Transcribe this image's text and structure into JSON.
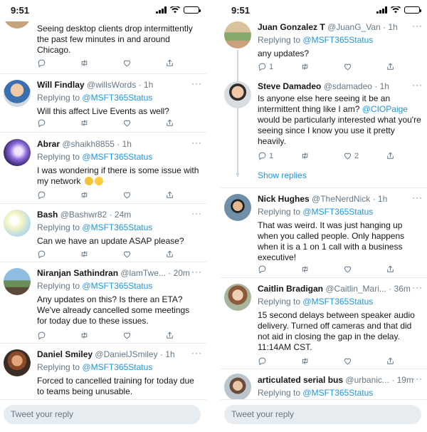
{
  "left": {
    "status_time": "9:51",
    "tweets": [
      {
        "body": "Seeing desktop clients drop intermittently the past few minutes in and around Chicago."
      },
      {
        "name": "Will Findlay",
        "handle": "@willsWords",
        "time": "· 1h",
        "replying_prefix": "Replying to",
        "replying_handle": "@MSFT365Status",
        "body": "Will this affect Live Events as well?"
      },
      {
        "name": "Abrar",
        "handle": "@shaikh8855",
        "time": "· 1h",
        "replying_prefix": "Replying to",
        "replying_handle": "@MSFT365Status",
        "body": "I was wondering if there is some issue with my network"
      },
      {
        "name": "Bash",
        "handle": "@Bashwr82",
        "time": "· 24m",
        "replying_prefix": "Replying to",
        "replying_handle": "@MSFT365Status",
        "body": "Can we have an update ASAP please?"
      },
      {
        "name": "Niranjan Sathindran",
        "handle": "@lamTwe...",
        "time": "· 20m",
        "replying_prefix": "Replying to",
        "replying_handle": "@MSFT365Status",
        "body": "Any updates on this? Is there an ETA? We've already cancelled some meetings for today due to these issues."
      },
      {
        "name": "Daniel Smiley",
        "handle": "@DanielJSmiley",
        "time": "· 1h",
        "replying_prefix": "Replying to",
        "replying_handle": "@MSFT365Status",
        "body": "Forced to cancelled training for today due to teams being unusable."
      }
    ],
    "compose_placeholder": "Tweet your reply"
  },
  "right": {
    "status_time": "9:51",
    "tweets": [
      {
        "name": "Juan Gonzalez T",
        "handle": "@JuanG_Van",
        "time": "· 1h",
        "replying_prefix": "Replying to",
        "replying_handle": "@MSFT365Status",
        "body": "any updates?",
        "reply_count": "1"
      },
      {
        "name": "Steve Damadeo",
        "handle": "@sdamadeo",
        "time": "· 1h",
        "body_before": "Is anyone else here seeing it be an intermittent thing like I am?",
        "body_mention": "@CIOPaige",
        "body_after": "would be particularly interested what you're seeing since I know you use it pretty heavily.",
        "reply_count": "1",
        "like_count": "2"
      },
      {
        "name": "Nick Hughes",
        "handle": "@TheNerdNick",
        "time": "· 1h",
        "replying_prefix": "Replying to",
        "replying_handle": "@MSFT365Status",
        "body": "That was weird. It was just hanging up when you called people. Only happens when it is a 1 on 1 call with a business executive!"
      },
      {
        "name": "Caitlin Bradigan",
        "handle": "@Caitlin_Mari...",
        "time": "· 36m",
        "replying_prefix": "Replying to",
        "replying_handle": "@MSFT365Status",
        "body": "15 second delays between speaker audio delivery. Turned off cameras and that did not aid in closing the gap in the delay. 11:14AM CST."
      },
      {
        "name": "articulated serial bus",
        "handle": "@urbanic...",
        "time": "· 19m",
        "replying_prefix": "Replying to",
        "replying_handle": "@MSFT365Status"
      }
    ],
    "show_replies": "Show replies",
    "compose_placeholder": "Tweet your reply"
  },
  "colors": {
    "accent": "#1b95e0",
    "muted": "#657786",
    "divider": "#e6ecf0"
  },
  "icons": [
    "reply-icon",
    "retweet-icon",
    "like-icon",
    "share-icon",
    "more-icon"
  ]
}
